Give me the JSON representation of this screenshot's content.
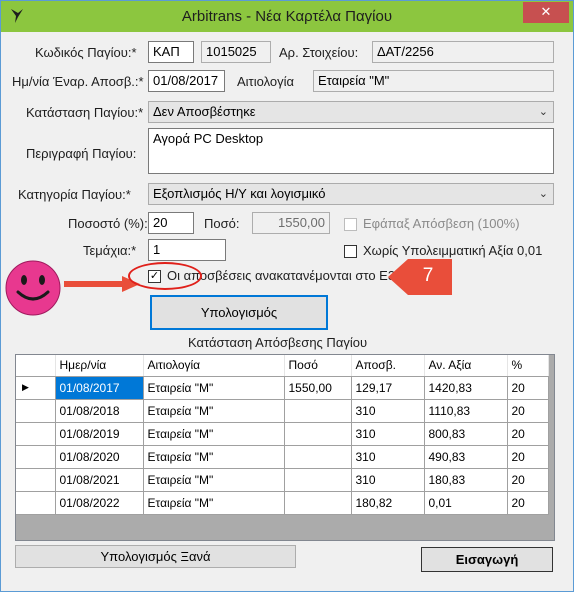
{
  "window": {
    "title": "Arbitrans - Νέα Καρτέλα Παγίου",
    "close_glyph": "✕"
  },
  "form": {
    "code_label": "Κωδικός Παγίου:*",
    "code_value": "ΚΑΠ",
    "code_number": "1015025",
    "item_no_label": "Αρ. Στοιχείου:",
    "item_no_value": "ΔΑΤ/2256",
    "start_date_label": "Ημ/νία Έναρ. Αποσβ.:*",
    "start_date_value": "01/08/2017",
    "reason_label": "Αιτιολογία",
    "reason_value": "Εταιρεία \"Μ\"",
    "status_label": "Κατάσταση Παγίου:*",
    "status_value": "Δεν Αποσβέστηκε",
    "description_label": "Περιγραφή Παγίου:",
    "description_value": "Αγορά PC Desktop",
    "category_label": "Κατηγορία Παγίου:*",
    "category_value": "Εξοπλισμός Η/Υ και λογισμικό",
    "percent_label": "Ποσοστό (%):",
    "percent_value": "20",
    "amount_label": "Ποσό:",
    "amount_value": "1550,00",
    "one_off_label": "Εφάπαξ Απόσβεση (100%)",
    "pieces_label": "Τεμάχια:*",
    "pieces_value": "1",
    "no_residual_label": "Χωρίς Υπολειμματική Αξία 0,01",
    "redistribute_label": "Οι αποσβέσεις ανακατανέμονται στο Ε3",
    "redistribute_checked": "✓"
  },
  "buttons": {
    "calculate": "Υπολογισμός",
    "recalculate": "Υπολογισμός Ξανά",
    "insert": "Εισαγωγή"
  },
  "grid": {
    "title": "Κατάσταση Απόσβεσης Παγίου",
    "columns": [
      "Ημερ/νία",
      "Αιτιολογία",
      "Ποσό",
      "Αποσβ.",
      "Αν. Αξία",
      "%"
    ],
    "current_row_marker": "▶",
    "rows": [
      [
        "01/08/2017",
        "Εταιρεία \"Μ\"",
        "1550,00",
        "129,17",
        "1420,83",
        "20"
      ],
      [
        "01/08/2018",
        "Εταιρεία \"Μ\"",
        "",
        "310",
        "1110,83",
        "20"
      ],
      [
        "01/08/2019",
        "Εταιρεία \"Μ\"",
        "",
        "310",
        "800,83",
        "20"
      ],
      [
        "01/08/2020",
        "Εταιρεία \"Μ\"",
        "",
        "310",
        "490,83",
        "20"
      ],
      [
        "01/08/2021",
        "Εταιρεία \"Μ\"",
        "",
        "310",
        "180,83",
        "20"
      ],
      [
        "01/08/2022",
        "Εταιρεία \"Μ\"",
        "",
        "180,82",
        "0,01",
        "20"
      ]
    ]
  },
  "annotation": {
    "step_number": "7",
    "accent_color": "#e94e3a",
    "smiley_color": "#e8388f"
  }
}
